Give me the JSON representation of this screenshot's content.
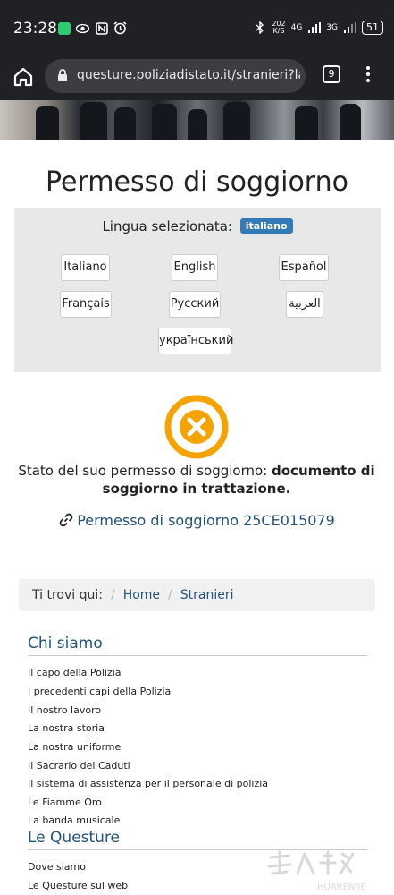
{
  "status_bar": {
    "time": "23:28",
    "net_speed_top": "202",
    "net_speed_bottom": "K/S",
    "net1": "4G",
    "net2": "3G",
    "battery": "51"
  },
  "browser": {
    "url": "questure.poliziadistato.it/stranieri?lang=",
    "tab_count": "9"
  },
  "page": {
    "title": "Permesso di soggiorno"
  },
  "language": {
    "label": "Lingua selezionata:",
    "selected_badge": "italiano",
    "options": [
      "Italiano",
      "English",
      "Español",
      "Français",
      "Русский",
      "العربية",
      "український"
    ]
  },
  "status": {
    "prefix": "Stato del suo permesso di soggiorno: ",
    "value": "documento di soggiorno in trattazione.",
    "permit_link": "Permesso di soggiorno 25CE015079",
    "icon_color": "#f5a300"
  },
  "breadcrumb": {
    "label": "Ti trovi qui:",
    "items": [
      "Home",
      "Stranieri"
    ]
  },
  "sections": [
    {
      "title": "Chi siamo",
      "items": [
        "Il capo della Polizia",
        "I precedenti capi della Polizia",
        "Il nostro lavoro",
        "La nostra storia",
        "La nostra uniforme",
        "Il Sacrario dei Caduti",
        "Il sistema di assistenza per il personale di polizia",
        "Le Fiamme Oro",
        "La banda musicale"
      ]
    },
    {
      "title": "Le Questure",
      "items": [
        "Dove siamo",
        "Le Questure sul web"
      ]
    }
  ],
  "watermark": {
    "text": "HUARENJIE"
  }
}
